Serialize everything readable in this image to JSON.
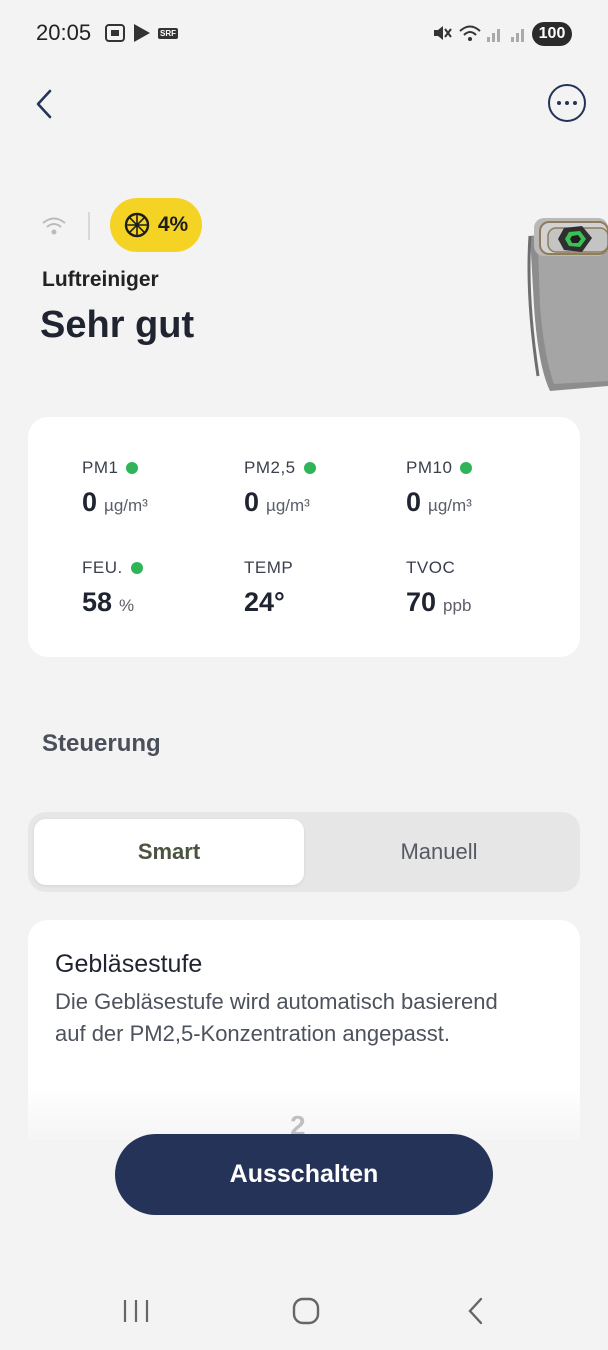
{
  "status_bar": {
    "time": "20:05",
    "srf_label": "SRF",
    "battery": "100"
  },
  "device": {
    "filter_percent": "4%",
    "type_label": "Luftreiniger",
    "air_quality": "Sehr gut"
  },
  "metrics": [
    {
      "label": "PM1",
      "value": "0",
      "unit": "µg/m³",
      "dot": true
    },
    {
      "label": "PM2,5",
      "value": "0",
      "unit": "µg/m³",
      "dot": true
    },
    {
      "label": "PM10",
      "value": "0",
      "unit": "µg/m³",
      "dot": true
    },
    {
      "label": "FEU.",
      "value": "58",
      "unit": "%",
      "dot": true
    },
    {
      "label": "TEMP",
      "value": "24°",
      "unit": "",
      "dot": false
    },
    {
      "label": "TVOC",
      "value": "70",
      "unit": "ppb",
      "dot": false
    }
  ],
  "control": {
    "section_title": "Steuerung",
    "modes": [
      "Smart",
      "Manuell"
    ],
    "active_mode": "Smart"
  },
  "fan": {
    "title": "Gebläsestufe",
    "description": "Die Gebläsestufe wird automatisch basierend auf der PM2,5-Konzentration angepasst.",
    "faded_value": "2"
  },
  "actions": {
    "power_off_label": "Ausschalten"
  },
  "colors": {
    "accent": "#243357",
    "badge": "#f5d325",
    "status_dot": "#2fb45a"
  }
}
